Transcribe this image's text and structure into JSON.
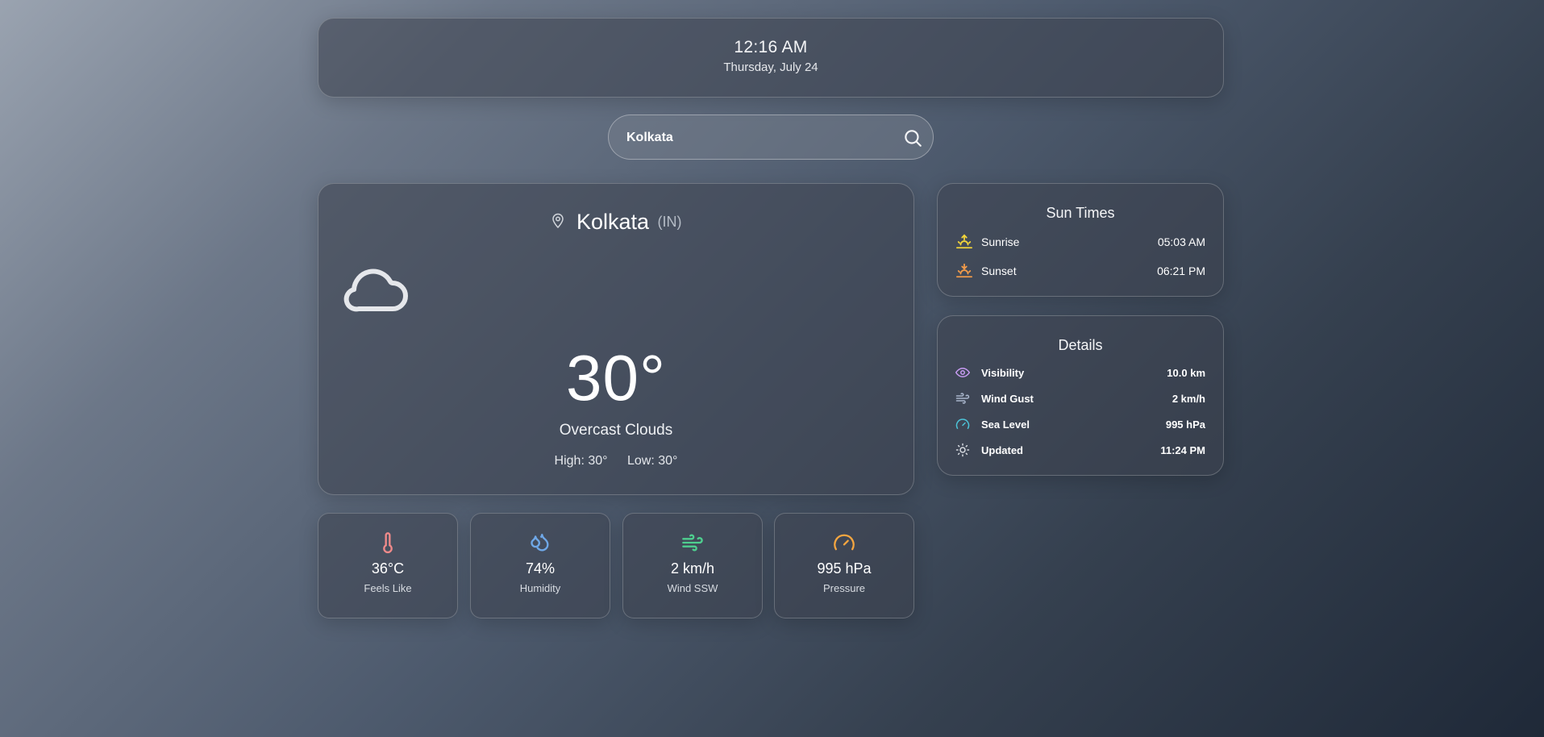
{
  "header": {
    "time": "12:16 AM",
    "date": "Thursday, July 24"
  },
  "search": {
    "value": "Kolkata",
    "placeholder": ""
  },
  "current": {
    "city": "Kolkata",
    "country": "(IN)",
    "icon": "cloud-icon",
    "temperature": "30°",
    "condition": "Overcast Clouds",
    "high": "High: 30°",
    "low": "Low: 30°"
  },
  "stats": [
    {
      "icon": "thermometer-icon",
      "value": "36°C",
      "label": "Feels Like",
      "color": "#f08a8a"
    },
    {
      "icon": "droplets-icon",
      "value": "74%",
      "label": "Humidity",
      "color": "#6fa8e8"
    },
    {
      "icon": "wind-icon",
      "value": "2 km/h",
      "label": "Wind SSW",
      "color": "#4ecf8f"
    },
    {
      "icon": "gauge-icon",
      "value": "995 hPa",
      "label": "Pressure",
      "color": "#f5a640"
    }
  ],
  "sun_times": {
    "title": "Sun Times",
    "items": [
      {
        "icon": "sunrise-icon",
        "label": "Sunrise",
        "value": "05:03 AM",
        "color": "#f2d43a"
      },
      {
        "icon": "sunset-icon",
        "label": "Sunset",
        "value": "06:21 PM",
        "color": "#f29b4a"
      }
    ]
  },
  "details": {
    "title": "Details",
    "items": [
      {
        "icon": "eye-icon",
        "label": "Visibility",
        "value": "10.0 km",
        "color": "#c79bf2"
      },
      {
        "icon": "wind-icon",
        "label": "Wind Gust",
        "value": "2 km/h",
        "color": "#a9b6cc"
      },
      {
        "icon": "gauge-icon",
        "label": "Sea Level",
        "value": "995 hPa",
        "color": "#4cc3d8"
      },
      {
        "icon": "sun-icon",
        "label": "Updated",
        "value": "11:24 PM",
        "color": "#d6dae0"
      }
    ]
  }
}
